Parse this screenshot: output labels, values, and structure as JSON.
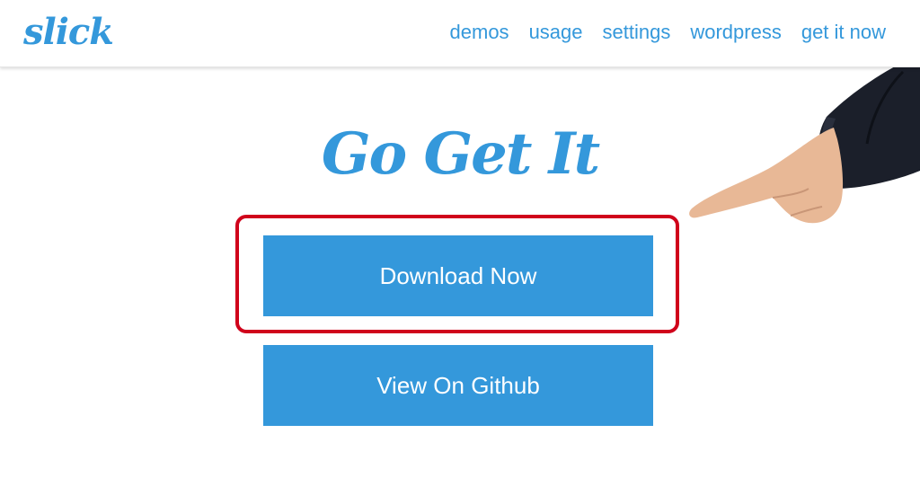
{
  "header": {
    "logo": "slick",
    "nav": [
      {
        "label": "demos"
      },
      {
        "label": "usage"
      },
      {
        "label": "settings"
      },
      {
        "label": "wordpress"
      },
      {
        "label": "get it now"
      }
    ]
  },
  "main": {
    "title": "Go Get It",
    "download_label": "Download Now",
    "github_label": "View On Github"
  },
  "colors": {
    "accent": "#3498db",
    "highlight": "#d0021b",
    "sleeve": "#1b1f2a",
    "skin": "#e8b896"
  },
  "icons": {
    "hand": "pointing-hand-icon"
  }
}
